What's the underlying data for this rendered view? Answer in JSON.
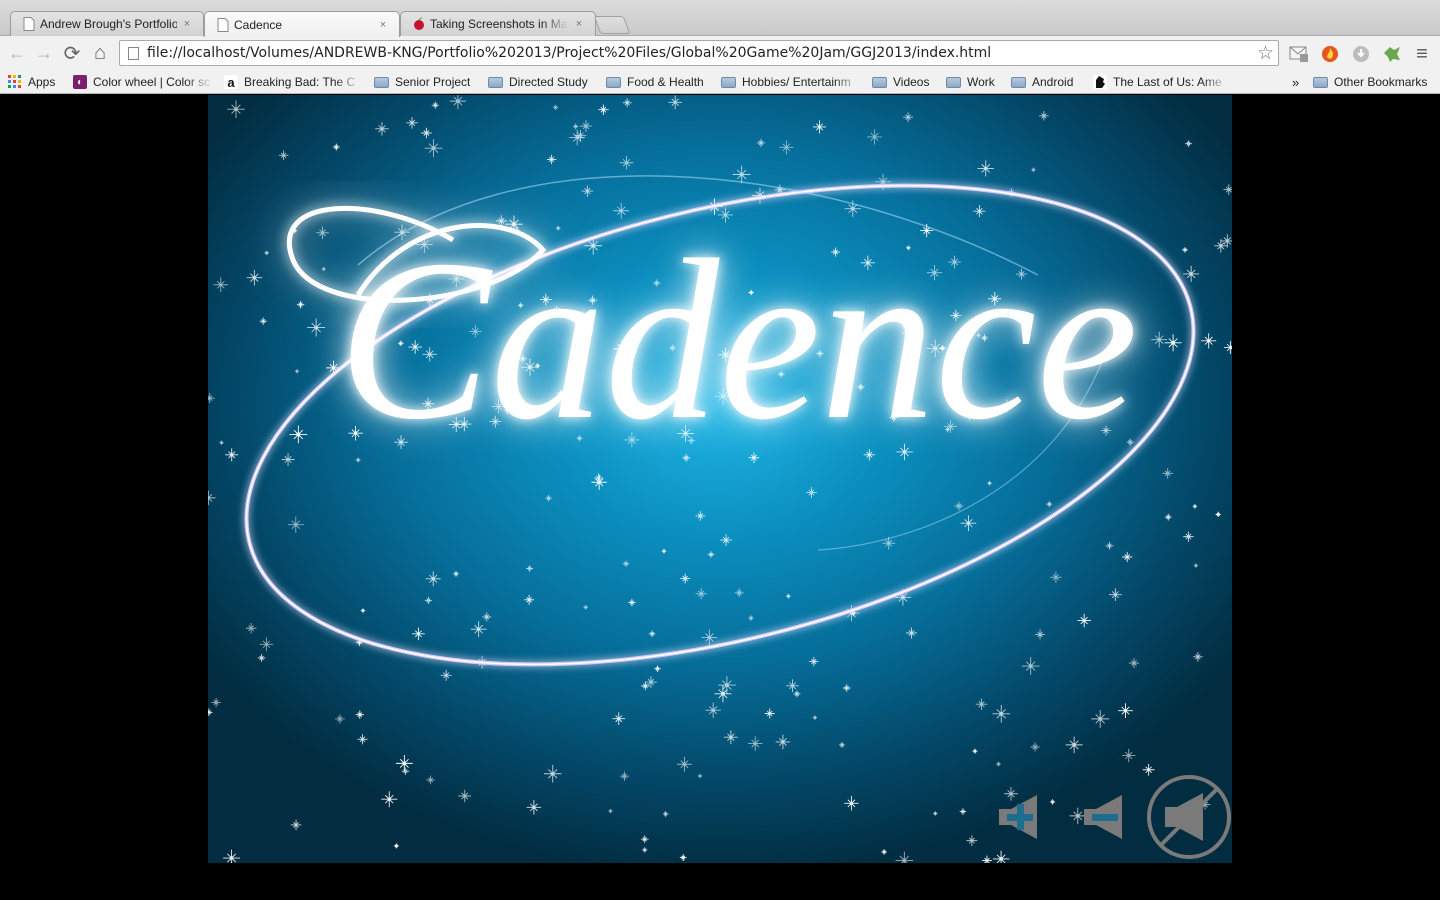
{
  "tabs": [
    {
      "title": "Andrew Brough's Portfolio",
      "close": "×",
      "active": false
    },
    {
      "title": "Cadence",
      "close": "×",
      "active": true
    },
    {
      "title": "Taking Screenshots in Mac",
      "close": "×",
      "active": false
    }
  ],
  "toolbar": {
    "back": "←",
    "forward": "→",
    "reload": "⟳",
    "home": "⌂",
    "url": "file://localhost/Volumes/ANDREWB-KNG/Portfolio%202013/Project%20Files/Global%20Game%20Jam/GGJ2013/index.html",
    "bookmark_star": "☆",
    "menu": "≡"
  },
  "bookmarks": {
    "items": [
      {
        "label": "Apps",
        "icon": "apps-grid-icon"
      },
      {
        "label": "Color wheel | Color sc",
        "icon": "color-wheel-icon"
      },
      {
        "label": "Breaking Bad: The C",
        "icon": "amazon-icon"
      },
      {
        "label": "Senior Project",
        "icon": "folder-icon"
      },
      {
        "label": "Directed Study",
        "icon": "folder-icon"
      },
      {
        "label": "Food & Health",
        "icon": "folder-icon"
      },
      {
        "label": "Hobbies/ Entertainm",
        "icon": "folder-icon"
      },
      {
        "label": "Videos",
        "icon": "folder-icon"
      },
      {
        "label": "Work",
        "icon": "folder-icon"
      },
      {
        "label": "Android",
        "icon": "folder-icon"
      },
      {
        "label": "The Last of Us: Ame",
        "icon": "last-of-us-icon"
      }
    ],
    "overflow": "»",
    "other": "Other Bookmarks"
  },
  "game": {
    "title": "Cadence",
    "controls": {
      "volume_up": "volume-up-icon",
      "volume_down": "volume-down-icon",
      "mute": "mute-icon"
    }
  },
  "colors": {
    "background_center": "#1fb6e6",
    "background_edge": "#022c40",
    "ring": "#d9ccff",
    "controls": "#7a7a7a"
  }
}
